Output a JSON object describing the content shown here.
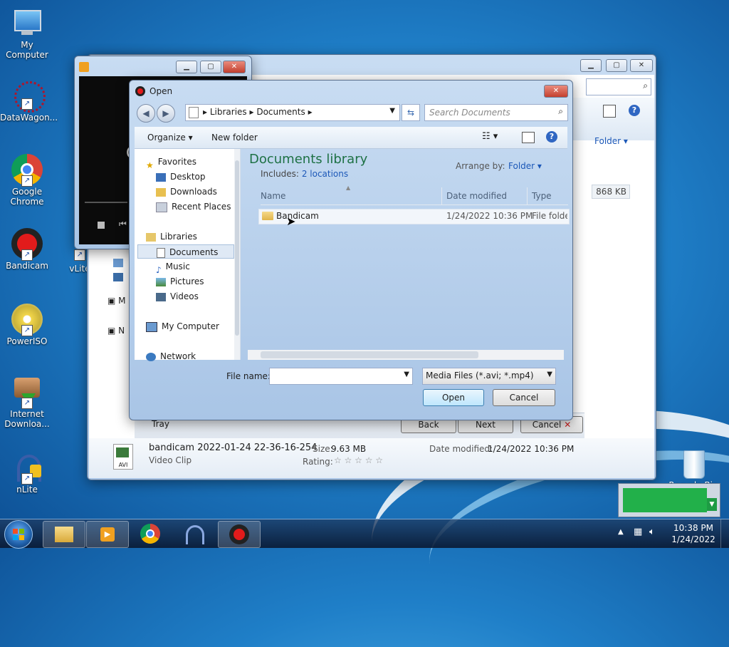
{
  "desktop_icons": [
    {
      "label": "My Computer"
    },
    {
      "label": "DataWagon..."
    },
    {
      "label": "Google Chrome"
    },
    {
      "label": "Bandicam"
    },
    {
      "label": "vLite"
    },
    {
      "label": "PowerISO"
    },
    {
      "label": "Internet Downloa..."
    },
    {
      "label": "nLite"
    },
    {
      "label": "Recycle Bin"
    }
  ],
  "back_window": {
    "arrange_label": "Folder",
    "size_value": "868 KB",
    "left_labels": [
      "M",
      "N"
    ],
    "tray_label": "Tray",
    "back_button": "Back",
    "next_button": "Next",
    "cancel_button": "Cancel",
    "details": {
      "name": "bandicam 2022-01-24 22-36-16-254",
      "type": "Video Clip",
      "size_label": "Size:",
      "size_value": "9.63 MB",
      "rating_label": "Rating:",
      "stars": "☆ ☆ ☆ ☆ ☆",
      "date_label": "Date modified:",
      "date_value": "1/24/2022 10:36 PM",
      "thumb_label": "AVI"
    }
  },
  "player_window": {
    "text_c": "C"
  },
  "dialog": {
    "title": "Open",
    "breadcrumb": [
      "Libraries",
      "Documents"
    ],
    "search_placeholder": "Search Documents",
    "organize": "Organize",
    "new_folder": "New folder",
    "library_title": "Documents library",
    "includes_label": "Includes:",
    "includes_link": "2 locations",
    "arrange_by_label": "Arrange by:",
    "arrange_by_value": "Folder",
    "columns": [
      "Name",
      "Date modified",
      "Type"
    ],
    "files": [
      {
        "name": "Bandicam",
        "date": "1/24/2022 10:36 PM",
        "type": "File folder"
      }
    ],
    "nav": {
      "favorites": "Favorites",
      "desktop": "Desktop",
      "downloads": "Downloads",
      "recent": "Recent Places",
      "libraries": "Libraries",
      "documents": "Documents",
      "music": "Music",
      "pictures": "Pictures",
      "videos": "Videos",
      "computer": "My Computer",
      "network": "Network"
    },
    "filename_label": "File name:",
    "filename_value": "",
    "filetype": "Media Files (*.avi; *.mp4)",
    "open_button": "Open",
    "cancel_button": "Cancel"
  },
  "taskbar": {
    "time": "10:38 PM",
    "date": "1/24/2022"
  },
  "colors": {
    "accent": "#1c58b8",
    "title_green": "#1e7145"
  }
}
